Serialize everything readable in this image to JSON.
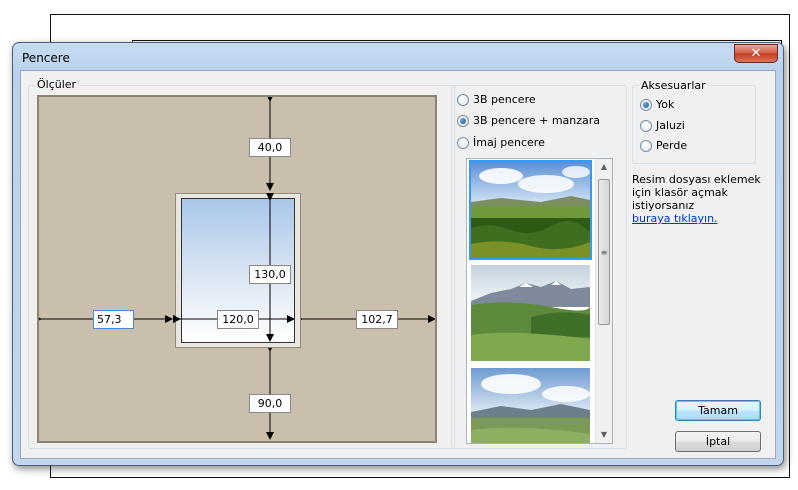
{
  "window": {
    "title": "Pencere",
    "close_glyph": "✕"
  },
  "dimensions": {
    "group_label": "Ölçüler",
    "top": "40,0",
    "height": "130,0",
    "left": "57,3",
    "width": "120,0",
    "right": "102,7",
    "bottom": "90,0"
  },
  "window_type": {
    "options": [
      {
        "label": "3B pencere",
        "selected": false
      },
      {
        "label": "3B pencere + manzara",
        "selected": true
      },
      {
        "label": "İmaj pencere",
        "selected": false
      }
    ]
  },
  "thumbnails": {
    "items": [
      {
        "name": "landscape-green-field",
        "selected": true
      },
      {
        "name": "landscape-mountains",
        "selected": false
      },
      {
        "name": "landscape-hills",
        "selected": false
      }
    ]
  },
  "accessories": {
    "group_label": "Aksesuarlar",
    "options": [
      {
        "label": "Yok",
        "selected": true
      },
      {
        "label": "Jaluzi",
        "selected": false
      },
      {
        "label": "Perde",
        "selected": false
      }
    ]
  },
  "info": {
    "text": "Resim dosyası eklemek için klasör açmak istiyorsanız",
    "link": "buraya tıklayın."
  },
  "buttons": {
    "ok": "Tamam",
    "cancel": "İptal"
  }
}
